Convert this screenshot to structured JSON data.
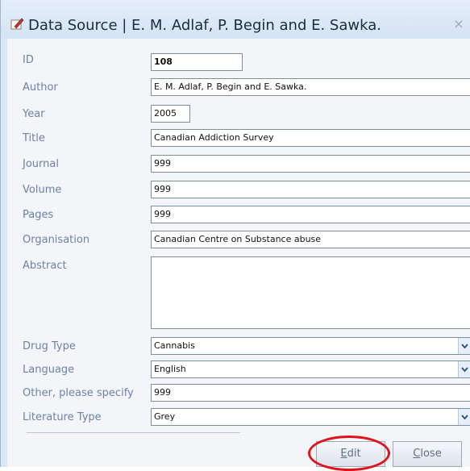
{
  "window": {
    "title": "Data Source | E. M. Adlaf, P. Begin and E. Sawka.",
    "close_glyph": "×"
  },
  "fields": [
    {
      "label": "ID",
      "value": "108"
    },
    {
      "label": "Author",
      "value": "E. M. Adlaf, P. Begin and E. Sawka."
    },
    {
      "label": "Year",
      "value": "2005"
    },
    {
      "label": "Title",
      "value": "Canadian Addiction Survey"
    },
    {
      "label": "Journal",
      "value": "999"
    },
    {
      "label": "Volume",
      "value": "999"
    },
    {
      "label": "Pages",
      "value": "999"
    },
    {
      "label": "Organisation",
      "value": "Canadian Centre on Substance abuse"
    },
    {
      "label": "Abstract",
      "value": ""
    },
    {
      "label": "Drug Type",
      "value": "Cannabis"
    },
    {
      "label": "Language",
      "value": "English"
    },
    {
      "label": "Other, please specify",
      "value": "999"
    },
    {
      "label": "Literature Type",
      "value": "Grey"
    }
  ],
  "buttons": {
    "edit": {
      "accel": "E",
      "rest": "dit"
    },
    "close": {
      "accel": "C",
      "rest": "lose"
    }
  },
  "colors": {
    "label": "#6b83a6",
    "highlight_ring": "#e0141b"
  },
  "icons": {
    "title": "pencil-edit-icon",
    "combo": "chevron-down-icon"
  }
}
